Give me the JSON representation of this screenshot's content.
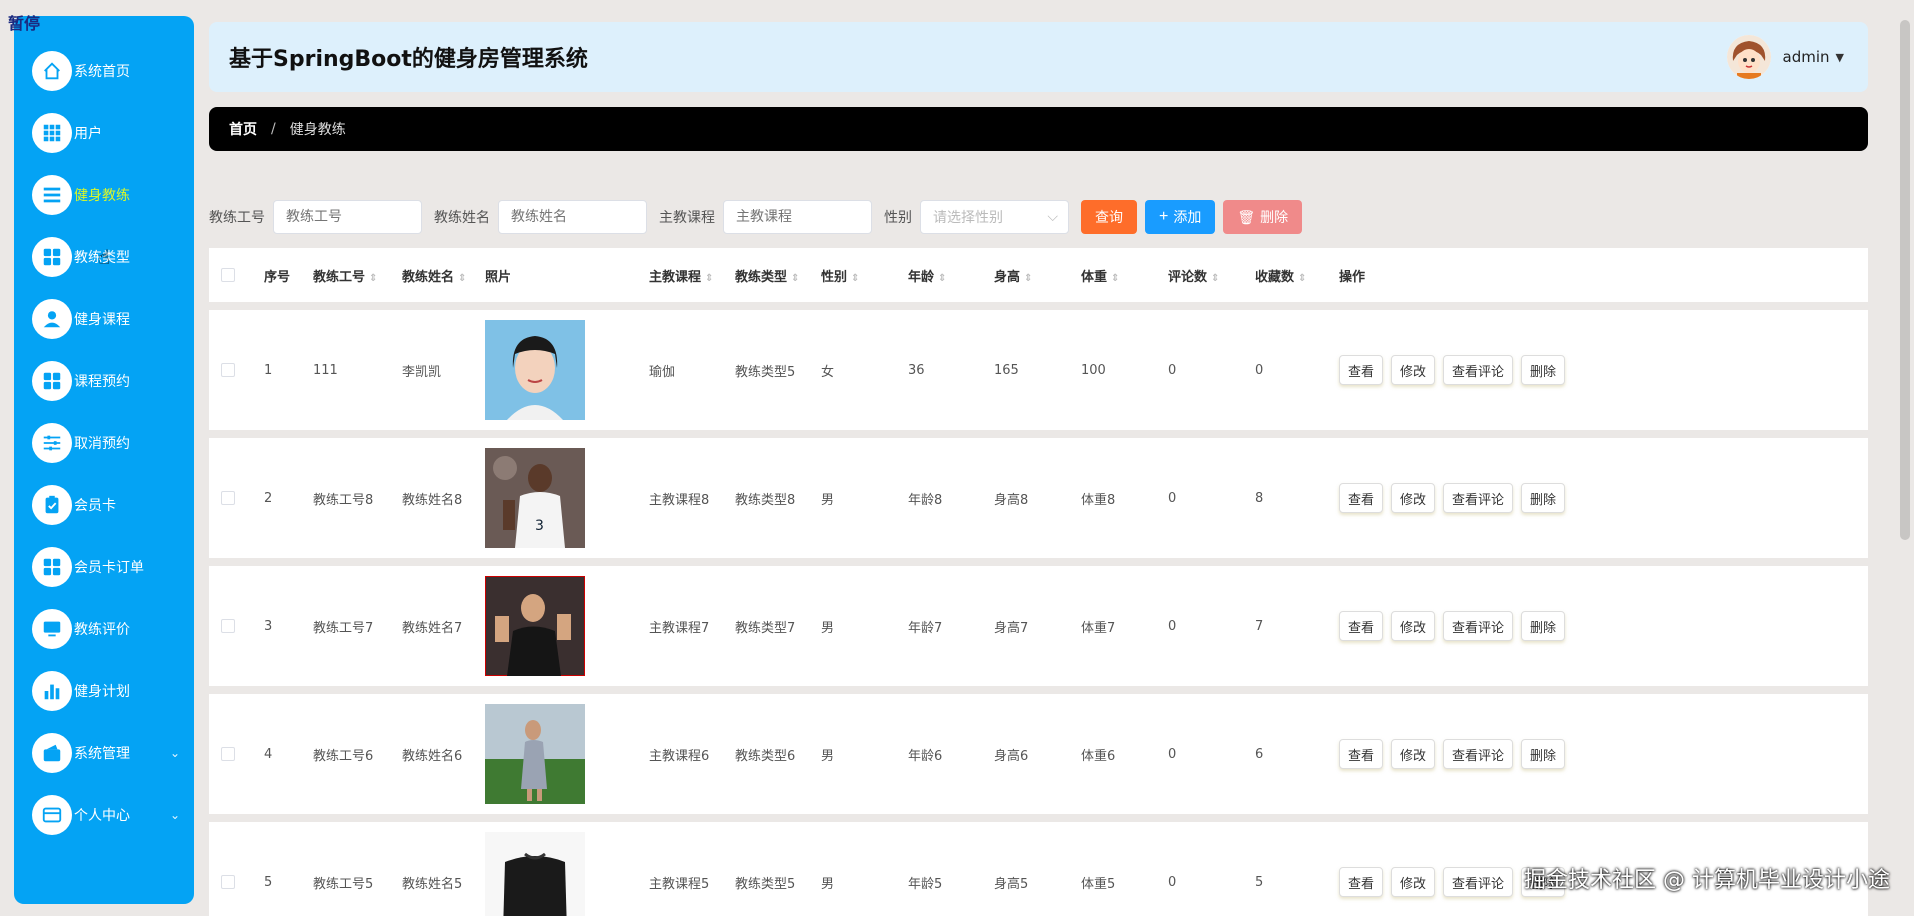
{
  "pause_label": "暂停",
  "sidebar": {
    "items": [
      {
        "label": "系统首页",
        "icon": "home-icon"
      },
      {
        "label": "用户",
        "icon": "grid-icon"
      },
      {
        "label": "健身教练",
        "icon": "list-icon"
      },
      {
        "label": "教练类型",
        "icon": "apps-icon"
      },
      {
        "label": "健身课程",
        "icon": "user-icon"
      },
      {
        "label": "课程预约",
        "icon": "apps-icon"
      },
      {
        "label": "取消预约",
        "icon": "sliders-icon"
      },
      {
        "label": "会员卡",
        "icon": "clipboard-icon"
      },
      {
        "label": "会员卡订单",
        "icon": "apps-icon"
      },
      {
        "label": "教练评价",
        "icon": "monitor-icon"
      },
      {
        "label": "健身计划",
        "icon": "bar-chart-icon"
      },
      {
        "label": "系统管理",
        "icon": "wallet-icon"
      },
      {
        "label": "个人中心",
        "icon": "card-icon"
      }
    ],
    "active": "健身教练",
    "accent": "#04a3f4",
    "active_text": "#d8f72a"
  },
  "header": {
    "title": "基于SpringBoot的健身房管理系统",
    "user": "admin"
  },
  "breadcrumb": {
    "home": "首页",
    "separator": "/",
    "current": "健身教练"
  },
  "search": {
    "coach_id_label": "教练工号",
    "coach_id_placeholder": "教练工号",
    "coach_name_label": "教练姓名",
    "coach_name_placeholder": "教练姓名",
    "course_label": "主教课程",
    "course_placeholder": "主教课程",
    "gender_label": "性别",
    "gender_placeholder": "请选择性别",
    "query": "查询",
    "add": "添加",
    "delete": "删除"
  },
  "table": {
    "columns": [
      "序号",
      "教练工号",
      "教练姓名",
      "照片",
      "主教课程",
      "教练类型",
      "性别",
      "年龄",
      "身高",
      "体重",
      "评论数",
      "收藏数",
      "操作"
    ],
    "rows": [
      {
        "no": "1",
        "id": "111",
        "name": "李凯凯",
        "course": "瑜伽",
        "type": "教练类型5",
        "gender": "女",
        "age": "36",
        "height": "165",
        "weight": "100",
        "comments": "0",
        "favorites": "0"
      },
      {
        "no": "2",
        "id": "教练工号8",
        "name": "教练姓名8",
        "course": "主教课程8",
        "type": "教练类型8",
        "gender": "男",
        "age": "年龄8",
        "height": "身高8",
        "weight": "体重8",
        "comments": "0",
        "favorites": "8"
      },
      {
        "no": "3",
        "id": "教练工号7",
        "name": "教练姓名7",
        "course": "主教课程7",
        "type": "教练类型7",
        "gender": "男",
        "age": "年龄7",
        "height": "身高7",
        "weight": "体重7",
        "comments": "0",
        "favorites": "7"
      },
      {
        "no": "4",
        "id": "教练工号6",
        "name": "教练姓名6",
        "course": "主教课程6",
        "type": "教练类型6",
        "gender": "男",
        "age": "年龄6",
        "height": "身高6",
        "weight": "体重6",
        "comments": "0",
        "favorites": "6"
      },
      {
        "no": "5",
        "id": "教练工号5",
        "name": "教练姓名5",
        "course": "主教课程5",
        "type": "教练类型5",
        "gender": "男",
        "age": "年龄5",
        "height": "身高5",
        "weight": "体重5",
        "comments": "0",
        "favorites": "5"
      }
    ],
    "actions": [
      "查看",
      "修改",
      "查看评论",
      "删除"
    ]
  },
  "watermark": "掘金技术社区 @ 计算机毕业设计小途"
}
